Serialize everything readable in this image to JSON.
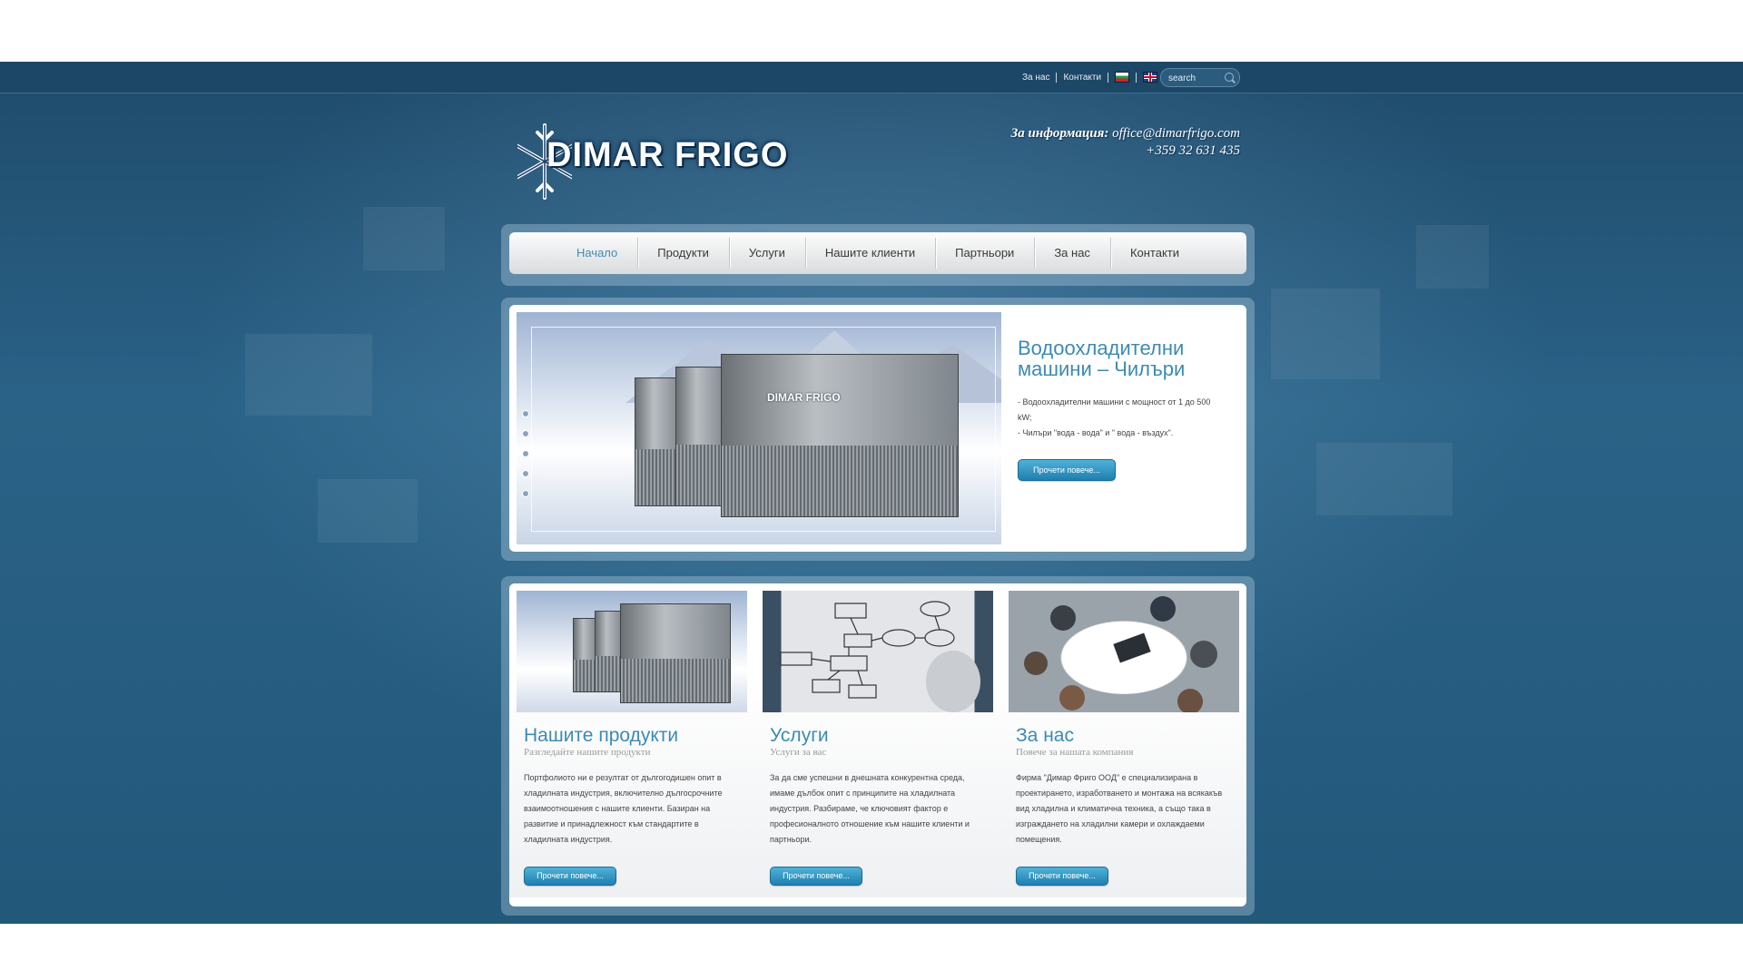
{
  "topbar": {
    "links": [
      "За нас",
      "Контакти"
    ],
    "flags": [
      "bulgarian-flag",
      "english-flag"
    ],
    "search_placeholder": "search"
  },
  "header": {
    "logo_text": "DIMAR FRIGO",
    "contact_label": "За информация:",
    "contact_email": "office@dimarfrigo.com",
    "contact_phone": "+359 32 631 435"
  },
  "nav": {
    "items": [
      "Начало",
      "Продукти",
      "Услуги",
      "Нашите клиенти",
      "Партньори",
      "За нас",
      "Контакти"
    ],
    "active": "Начало"
  },
  "featured": {
    "image_logo": "DIMAR FRIGO",
    "title": "Водоохладителни машини – Чилъри",
    "line1": "- Водоохладителни машини с мощност от 1 до 500 kW;",
    "line2": "- Чилъри \"вода - вода\" и \" вода - въздух\".",
    "button": "Прочети повече..."
  },
  "columns": [
    {
      "title": "Нашите продукти",
      "subtitle": "Разгледайте нашите продукти",
      "text": "Портфолиото ни е резултат от дългогодишен опит в хладилната индустрия, включително дългосрочните взаимоотношения с нашите клиенти. Базиран на развитие и принадлежност към стандартите в хладилната индустрия.",
      "button": "Прочети повече..."
    },
    {
      "title": "Услуги",
      "subtitle": "Услуги за вас",
      "text": "За да сме успешни в днешната конкурентна среда, имаме дълбок опит с принципите на хладилната индустрия. Разбираме, че ключовият фактор е професионалното отношение към нашите клиенти и партньори.",
      "button": "Прочети повече..."
    },
    {
      "title": "За нас",
      "subtitle": "Повече за нашата компания",
      "text": "Фирма \"Димар Фриго ООД\" е специализирана в проектирането, изработването и монтажа на всякакъв вид хладилна и климатична техника, а също така в изграждането на хладилни камери и охлаждаеми помещения.",
      "button": "Прочети повече..."
    }
  ],
  "colors": {
    "accent_blue": "#3d8ab3",
    "background_blue": "#22587a",
    "button_blue": "#1f7fb0"
  }
}
